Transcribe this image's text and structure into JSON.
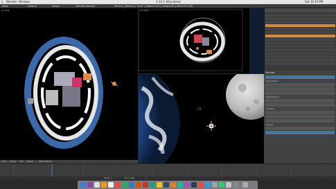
{
  "menubar": {
    "apple": "",
    "app": "Blender",
    "window": "Window",
    "title": "1-12-1 Ship.blend",
    "clock": "Sat 10:19 PM"
  },
  "header": {
    "help": "Help",
    "layout": "Default",
    "scene": "Scene",
    "engine": "Blender Render",
    "stats": "Verts:0 | Faces:0 | Tris:0 | Objects:0/0 | Lamps:0/0 | Mem:25.13M"
  },
  "viewports": {
    "left_label": "(1) Ship",
    "right_top_label": "(1) Ship",
    "right_bottom_label": "(1) Ship",
    "footer_view": "View",
    "footer_select": "Select",
    "footer_add": "Add",
    "footer_object": "Object",
    "footer_mode": "Object Mode"
  },
  "properties": {
    "tab": "Render",
    "dims": "Dimensions",
    "aa": "Anti-Aliasing",
    "shading": "Shading",
    "output": "Output"
  },
  "timeline": {
    "start": "Start: 1",
    "end": "End: 250",
    "frame": "1"
  },
  "colors": {
    "selection": "#d28d3a",
    "accent": "#4a73ad"
  }
}
